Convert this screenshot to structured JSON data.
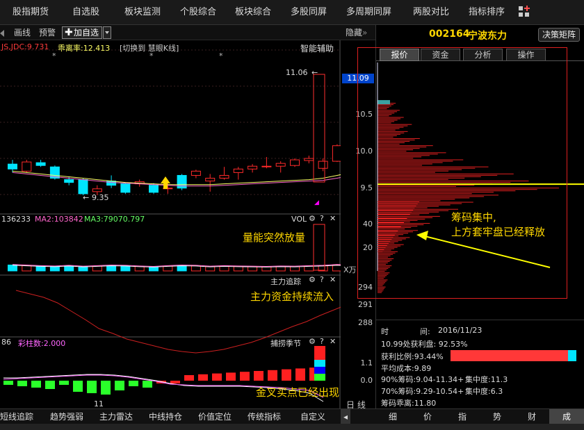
{
  "topnav": {
    "items": [
      "股指期货",
      "自选股",
      "板块监测",
      "个股综合",
      "板块综合",
      "多股同屏",
      "多周期同屏",
      "两股对比",
      "指标排序"
    ]
  },
  "toolbar": {
    "draw": "画线",
    "alert": "预警",
    "add": "加自选",
    "hide": "隐藏"
  },
  "stock": {
    "code": "002164",
    "name": "宁波东力",
    "matrix": "决策矩阵"
  },
  "kline": {
    "legend_ind": "JS,JDC:9.731",
    "legend_bias": "乖离率:12.413",
    "legend_switch": "[切换到 慧眼K线]",
    "assist": "智能辅助",
    "high": "11.06",
    "low": "9.35"
  },
  "vol": {
    "ma1": "136233",
    "ma2": "MA2:103842",
    "ma3": "MA3:79070.797",
    "label": "VOL",
    "unit": "X万"
  },
  "zlzz": {
    "label": "主力追踪"
  },
  "blj": {
    "val": "86",
    "ccs": "彩柱数:2.000",
    "label": "捕捞季节",
    "date": "11"
  },
  "annotations": {
    "vol": "量能突然放量",
    "zl": "主力资金持续流入",
    "cross": "金叉买点已经出现",
    "chips1": "筹码集中,",
    "chips2": "上方套牢盘已经释放"
  },
  "axis": {
    "price": [
      "10.5",
      "10.0",
      "9.5"
    ],
    "current": "11.09",
    "vol": [
      "40",
      "20"
    ],
    "zl": [
      "294",
      "291",
      "288"
    ],
    "blj": [
      "1.1",
      "0.0"
    ],
    "period": "日 线"
  },
  "tabs": {
    "quote": "报价",
    "fund": "资金",
    "analysis": "分析",
    "operate": "操作"
  },
  "stats": {
    "time_label": "时",
    "time_mid": "间:",
    "time_val": "2016/11/23",
    "profit_at": "10.99处获利盘: 92.53%",
    "profit_ratio": "获利比例:93.44%",
    "avg_cost": "平均成本:9.89",
    "c90": "90%筹码:9.04-11.34+",
    "c90c": "集中度:11.3",
    "c70": "70%筹码:9.29-10.54+",
    "c70c": "集中度:6.3",
    "deviation": "筹码乖离:11.80",
    "ratio": 0.9344
  },
  "bottomtabs": [
    "短线追踪",
    "趋势强弱",
    "主力雷达",
    "中线持仓",
    "价值定位",
    "传统指标",
    "自定义"
  ],
  "rbtabs": [
    "细",
    "价",
    "指",
    "势",
    "财",
    "成"
  ],
  "chart_data": {
    "type": "candlestick",
    "candles": [
      {
        "o": 9.82,
        "c": 9.75,
        "h": 9.88,
        "l": 9.7
      },
      {
        "o": 9.72,
        "c": 9.85,
        "h": 9.88,
        "l": 9.7
      },
      {
        "o": 9.84,
        "c": 9.8,
        "h": 9.88,
        "l": 9.78
      },
      {
        "o": 9.78,
        "c": 9.62,
        "h": 9.8,
        "l": 9.6
      },
      {
        "o": 9.6,
        "c": 9.56,
        "h": 9.64,
        "l": 9.52
      },
      {
        "o": 9.6,
        "c": 9.4,
        "h": 9.62,
        "l": 9.38
      },
      {
        "o": 9.43,
        "c": 9.47,
        "h": 9.52,
        "l": 9.38
      },
      {
        "o": 9.58,
        "c": 9.52,
        "h": 9.66,
        "l": 9.48
      },
      {
        "o": 9.54,
        "c": 9.42,
        "h": 9.56,
        "l": 9.4
      },
      {
        "o": 9.54,
        "c": 9.57,
        "h": 9.6,
        "l": 9.5
      },
      {
        "o": 9.52,
        "c": 9.42,
        "h": 9.55,
        "l": 9.4
      },
      {
        "o": 9.48,
        "c": 9.48,
        "h": 9.55,
        "l": 9.4
      },
      {
        "o": 9.66,
        "c": 9.48,
        "h": 9.68,
        "l": 9.45
      },
      {
        "o": 9.66,
        "c": 9.72,
        "h": 9.74,
        "l": 9.62
      },
      {
        "o": 9.58,
        "c": 9.62,
        "h": 9.68,
        "l": 9.43
      },
      {
        "o": 9.62,
        "c": 9.66,
        "h": 9.78,
        "l": 9.6
      },
      {
        "o": 9.7,
        "c": 9.75,
        "h": 9.78,
        "l": 9.6
      },
      {
        "o": 9.75,
        "c": 9.79,
        "h": 9.82,
        "l": 9.7
      },
      {
        "o": 9.79,
        "c": 9.79,
        "h": 9.92,
        "l": 9.76
      },
      {
        "o": 9.79,
        "c": 9.83,
        "h": 9.86,
        "l": 9.7
      },
      {
        "o": 9.8,
        "c": 9.88,
        "h": 9.9,
        "l": 9.78
      },
      {
        "o": 9.87,
        "c": 9.9,
        "h": 9.94,
        "l": 9.83
      },
      {
        "o": 9.76,
        "c": 9.86,
        "h": 9.9,
        "l": 9.72
      },
      {
        "o": 9.86,
        "c": 10.08,
        "h": 10.1,
        "l": 9.85
      },
      {
        "o": 10.08,
        "c": 10.05,
        "h": 10.12,
        "l": 9.9
      },
      {
        "o": 10.02,
        "c": 10.1,
        "h": 10.2,
        "l": 10.0
      },
      {
        "o": 10.1,
        "c": 11.06,
        "h": 11.06,
        "l": 10.1
      }
    ],
    "ma": [
      9.72,
      9.7,
      9.68,
      9.66,
      9.64,
      9.62,
      9.6,
      9.58,
      9.56,
      9.55,
      9.54,
      9.53,
      9.53,
      9.53,
      9.53,
      9.54,
      9.55,
      9.56,
      9.57,
      9.58,
      9.59,
      9.6,
      9.62,
      9.66,
      9.7,
      9.76,
      9.85
    ],
    "ma2": [
      9.7,
      9.68,
      9.66,
      9.64,
      9.62,
      9.6,
      9.58,
      9.56,
      9.55,
      9.54,
      9.53,
      9.52,
      9.51,
      9.51,
      9.51,
      9.52,
      9.53,
      9.54,
      9.55,
      9.56,
      9.57,
      9.58,
      9.59,
      9.62,
      9.66,
      9.72,
      9.8
    ],
    "volumes": [
      55,
      50,
      45,
      42,
      48,
      40,
      45,
      50,
      48,
      42,
      38,
      45,
      50,
      48,
      40,
      45,
      42,
      40,
      38,
      42,
      40,
      45,
      48,
      55,
      50,
      65,
      390
    ],
    "chips": [
      {
        "p": 11.0,
        "v": 18
      },
      {
        "p": 10.9,
        "v": 22
      },
      {
        "p": 10.8,
        "v": 26
      },
      {
        "p": 10.7,
        "v": 34
      },
      {
        "p": 10.6,
        "v": 30
      },
      {
        "p": 10.5,
        "v": 42
      },
      {
        "p": 10.4,
        "v": 55
      },
      {
        "p": 10.3,
        "v": 68
      },
      {
        "p": 10.2,
        "v": 85
      },
      {
        "p": 10.1,
        "v": 110
      },
      {
        "p": 10.0,
        "v": 135
      },
      {
        "p": 9.9,
        "v": 150
      },
      {
        "p": 9.8,
        "v": 180
      },
      {
        "p": 9.7,
        "v": 120
      },
      {
        "p": 9.6,
        "v": 95
      },
      {
        "p": 9.5,
        "v": 80
      },
      {
        "p": 9.4,
        "v": 62
      },
      {
        "p": 9.3,
        "v": 52
      },
      {
        "p": 9.2,
        "v": 40
      },
      {
        "p": 9.1,
        "v": 32
      },
      {
        "p": 9.0,
        "v": 26
      },
      {
        "p": 8.9,
        "v": 20
      },
      {
        "p": 8.8,
        "v": 16
      },
      {
        "p": 8.7,
        "v": 14
      },
      {
        "p": 8.6,
        "v": 12
      },
      {
        "p": 8.5,
        "v": 10
      },
      {
        "p": 8.4,
        "v": 8
      }
    ],
    "avg_cost": 9.89
  },
  "colors": {
    "up": "#ff2a2a",
    "down": "#00e5ff",
    "ma1": "#ffff66",
    "ma2": "#ff66cc",
    "accent": "#ffd700"
  }
}
